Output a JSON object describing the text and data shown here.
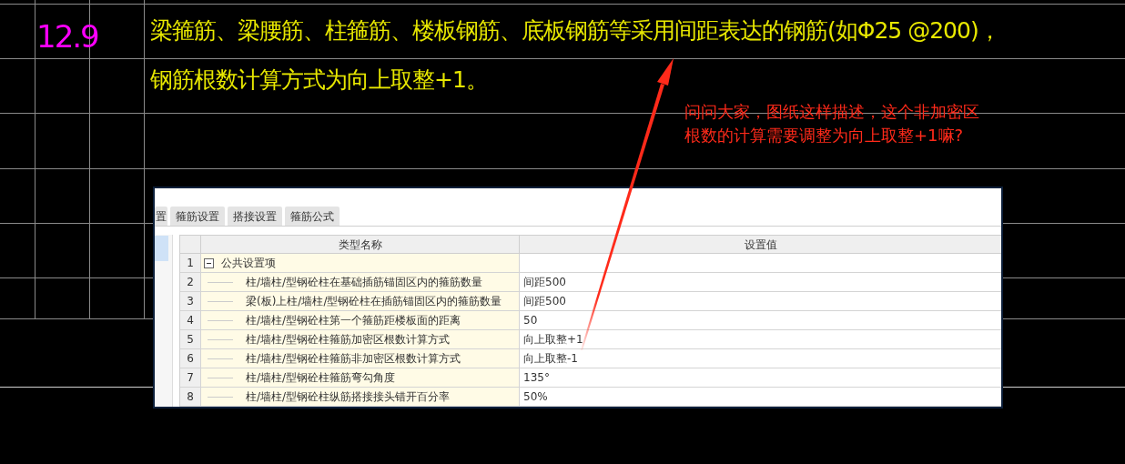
{
  "drawing": {
    "number": "12.9",
    "lines": [
      "梁箍筋、梁腰筋、柱箍筋、楼板钢筋、底板钢筋等采用间距表达的钢筋(如Φ25 @200)，",
      "钢筋根数计算方式为向上取整+1。"
    ]
  },
  "annotation": {
    "lines": [
      "问问大家，图纸这样描述，这个非加密区",
      "根数的计算需要调整为向上取整+1嘛?"
    ]
  },
  "settings_window": {
    "tabs": [
      "置",
      "箍筋设置",
      "搭接设置",
      "箍筋公式"
    ],
    "table": {
      "columns": [
        "类型名称",
        "设置值"
      ],
      "rows": [
        {
          "number": "1",
          "name": "公共设置项",
          "expanded": true,
          "children": [
            {
              "number": "2",
              "name": "柱/墙柱/型钢砼柱在基础插筋锚固区内的箍筋数量",
              "value": "间距500"
            },
            {
              "number": "3",
              "name": "梁(板)上柱/墙柱/型钢砼柱在插筋锚固区内的箍筋数量",
              "value": "间距500"
            },
            {
              "number": "4",
              "name": "柱/墙柱/型钢砼柱第一个箍筋距楼板面的距离",
              "value": "50"
            },
            {
              "number": "5",
              "name": "柱/墙柱/型钢砼柱箍筋加密区根数计算方式",
              "value": "向上取整+1"
            },
            {
              "number": "6",
              "name": "柱/墙柱/型钢砼柱箍筋非加密区根数计算方式",
              "value": "向上取整-1"
            },
            {
              "number": "7",
              "name": "柱/墙柱/型钢砼柱箍筋弯勾角度",
              "value": "135°"
            },
            {
              "number": "8",
              "name": "柱/墙柱/型钢砼柱纵筋搭接接头错开百分率",
              "value": "50%"
            }
          ]
        }
      ]
    }
  }
}
